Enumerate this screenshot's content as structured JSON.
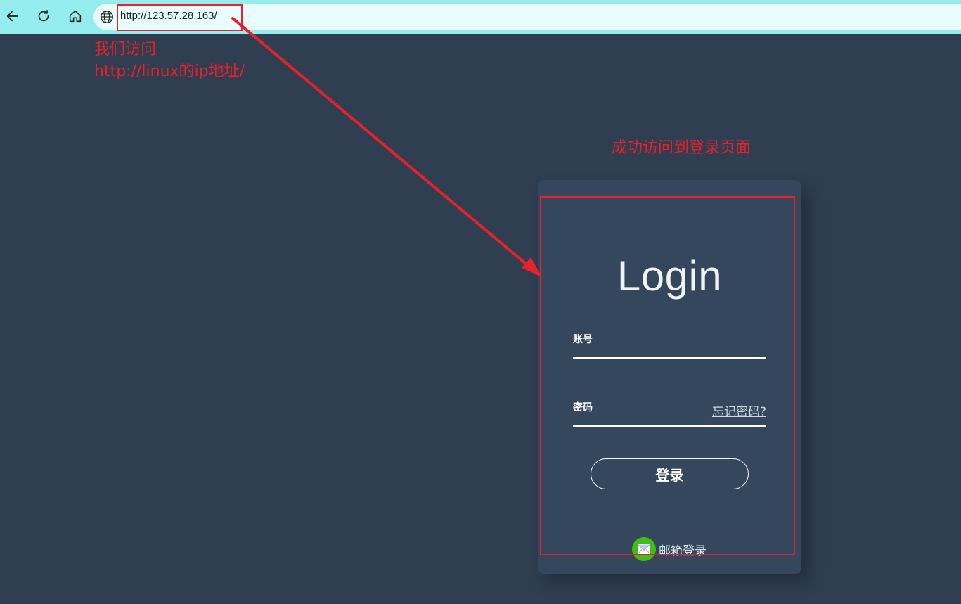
{
  "browser": {
    "url": "http://123.57.28.163/",
    "back_icon": "back-arrow-icon",
    "refresh_icon": "refresh-icon",
    "home_icon": "home-icon",
    "site_icon": "globe-icon"
  },
  "login": {
    "title": "Login",
    "account_label": "账号",
    "account_value": "",
    "password_label": "密码",
    "password_value": "",
    "forgot_link": "忘记密码?",
    "submit_label": "登录",
    "email_login_label": "邮箱登录",
    "email_icon": "email-icon"
  },
  "annotations": {
    "line1": "我们访问",
    "line2": "http://linux的ip地址/",
    "line3": "成功访问到登录页面",
    "color": "#e8202a"
  },
  "colors": {
    "toolbar": "#95ecef",
    "page_bg": "#2f3e51",
    "card_bg": "#34475d"
  }
}
